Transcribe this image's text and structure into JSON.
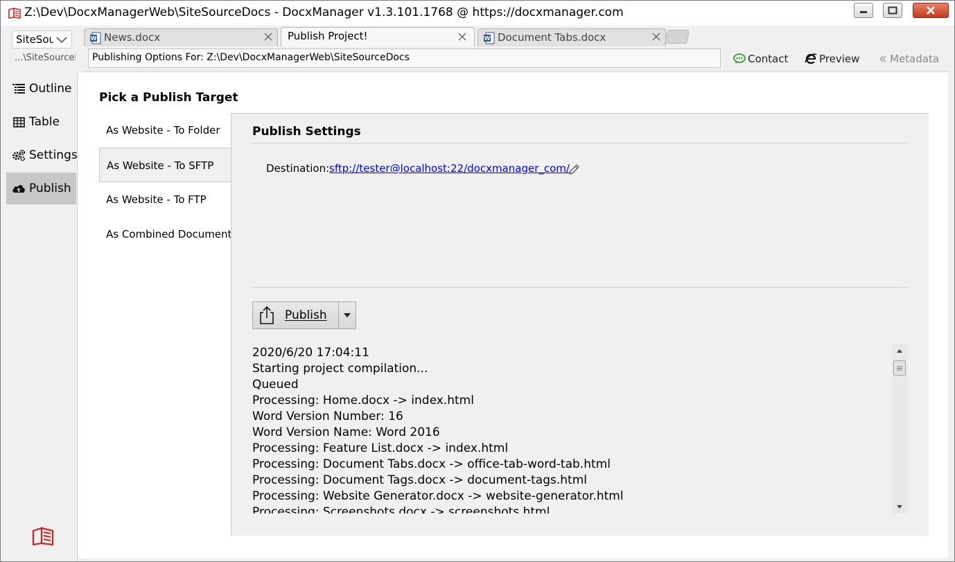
{
  "window": {
    "title": "Z:\\Dev\\DocxManagerWeb\\SiteSourceDocs - DocxManager v1.3.101.1768  @  https://docxmanager.com",
    "buttons": [
      "minimize-icon",
      "maximize-icon",
      "close-icon"
    ]
  },
  "project": {
    "selector_value": "SiteSourceDocs",
    "path": "...\\SiteSourceDocs"
  },
  "tabs": [
    {
      "label": "News.docx",
      "icon": "word-doc-icon",
      "active": false
    },
    {
      "label": "Publish Project!",
      "active": true
    },
    {
      "label": "Document Tabs.docx",
      "icon": "word-doc-icon",
      "active": false
    }
  ],
  "address": {
    "text": "Publishing Options For: Z:\\Dev\\DocxManagerWeb\\SiteSourceDocs"
  },
  "top_actions": {
    "contact": "Contact",
    "preview": "Preview",
    "metadata": "Metadata"
  },
  "nav": [
    {
      "label": "Outline",
      "icon": "outline-icon",
      "selected": false
    },
    {
      "label": "Table",
      "icon": "table-icon",
      "selected": false
    },
    {
      "label": "Settings",
      "icon": "gears-icon",
      "selected": false
    },
    {
      "label": "Publish",
      "icon": "cloud-upload-icon",
      "selected": true
    }
  ],
  "main": {
    "pick_title": "Pick a Publish Target",
    "targets": [
      {
        "label": "As Website - To Folder",
        "selected": false
      },
      {
        "label": "As Website - To SFTP",
        "selected": true
      },
      {
        "label": "As Website - To FTP",
        "selected": false
      },
      {
        "label": "As Combined Document",
        "selected": false
      }
    ],
    "settings": {
      "title": "Publish Settings",
      "destination_label": "Destination:",
      "destination_value": "sftp://tester@localhost:22/docxmanager_com/"
    },
    "publish_button": {
      "label": "Publish",
      "access_key": "P"
    },
    "log": [
      "2020/6/20 17:04:11",
      "Starting project compilation...",
      "Queued",
      "Processing: Home.docx -> index.html",
      "Word Version Number: 16",
      "Word Version Name: Word 2016",
      "Processing: Feature List.docx -> index.html",
      "Processing: Document Tabs.docx -> office-tab-word-tab.html",
      "Processing: Document Tags.docx -> document-tags.html",
      "Processing: Website Generator.docx -> website-generator.html",
      "Processing: Screenshots.docx -> screenshots.html"
    ]
  },
  "colors": {
    "link": "#0000ee",
    "close_button": "#c43a1d",
    "nav_selected": "#c7c7c7",
    "logo_red": "#d11f1f",
    "contact_icon": "#2da02d"
  }
}
